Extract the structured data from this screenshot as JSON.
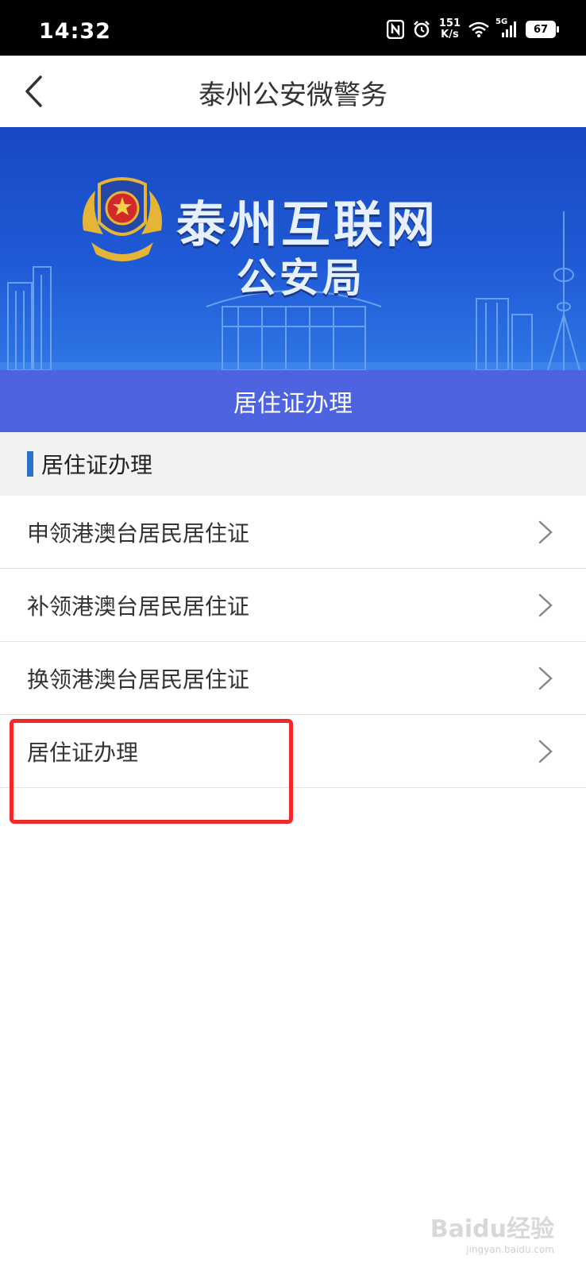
{
  "status_bar": {
    "time": "14:32",
    "speed_value": "151",
    "speed_unit": "K/s",
    "network": "5G",
    "battery": "67"
  },
  "header": {
    "title": "泰州公安微警务",
    "back_icon": "chevron-left-icon"
  },
  "banner": {
    "line1": "泰州互联网",
    "line2": "公安局"
  },
  "page_title": "居住证办理",
  "section": {
    "label": "居住证办理",
    "accent": "#2b73c9"
  },
  "items": [
    {
      "label": "申领港澳台居民居住证"
    },
    {
      "label": "补领港澳台居民居住证"
    },
    {
      "label": "换领港澳台居民居住证"
    },
    {
      "label": "居住证办理"
    }
  ],
  "watermark": {
    "brand": "Baidu经验",
    "url": "jingyan.baidu.com"
  },
  "colors": {
    "banner": "#1f5ad6",
    "title_bar": "#4d63e0",
    "highlight": "#ee2a2a"
  }
}
